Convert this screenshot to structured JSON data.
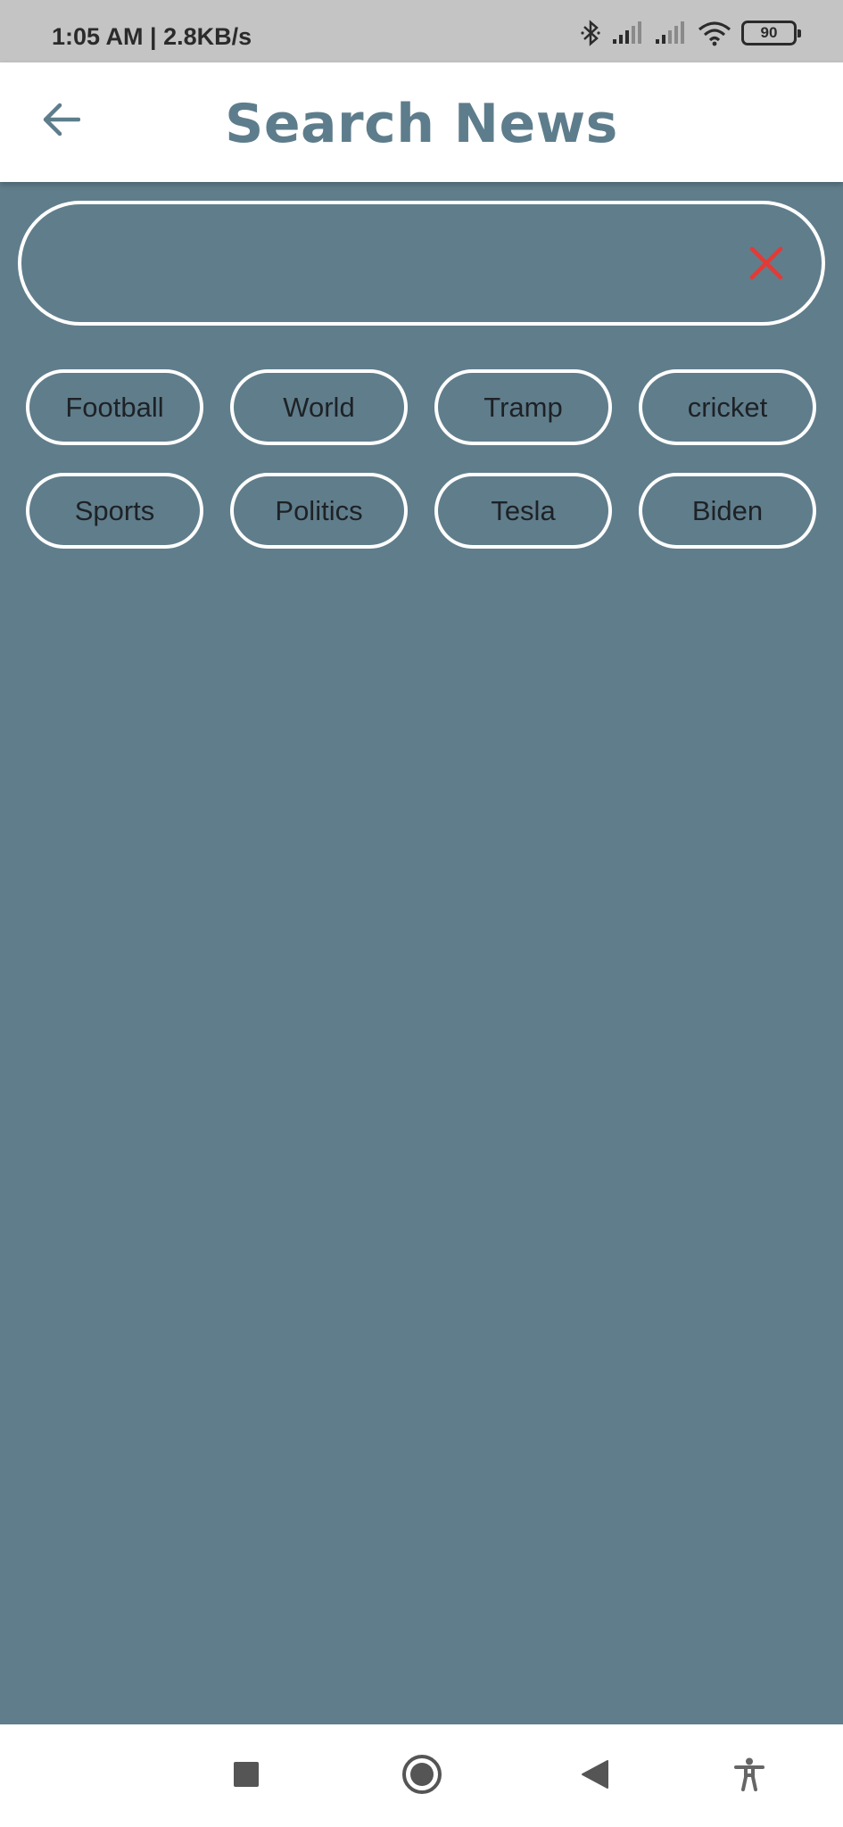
{
  "status_bar": {
    "time_speed": "1:05 AM | 2.8KB/s",
    "battery_level": "90",
    "icons": [
      "bluetooth-icon",
      "signal-icon",
      "signal-icon",
      "wifi-icon",
      "battery-icon"
    ]
  },
  "app_bar": {
    "title": "Search News",
    "back_icon": "arrow-left-icon"
  },
  "search": {
    "value": "",
    "placeholder": "",
    "clear_icon": "close-icon",
    "clear_icon_color": "#e53935"
  },
  "chips": {
    "items": [
      {
        "label": "Football"
      },
      {
        "label": "World"
      },
      {
        "label": "Tramp"
      },
      {
        "label": "cricket"
      },
      {
        "label": "Sports"
      },
      {
        "label": "Politics"
      },
      {
        "label": "Tesla"
      },
      {
        "label": "Biden"
      }
    ]
  },
  "nav_bar": {
    "buttons": [
      "recents-square-icon",
      "home-circle-icon",
      "back-triangle-icon",
      "accessibility-icon"
    ]
  },
  "colors": {
    "background": "#607d8b",
    "app_bar": "#ffffff",
    "title": "#5e7d8c",
    "status_bar": "#c4c4c4",
    "chip_border": "#ffffff"
  }
}
